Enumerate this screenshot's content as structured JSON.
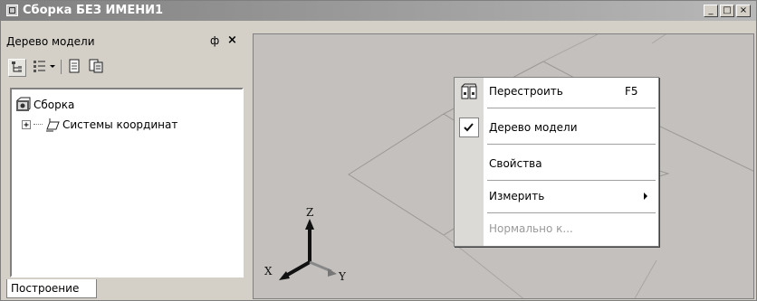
{
  "window": {
    "title": "Сборка БЕЗ ИМЕНИ1",
    "controls": [
      "_",
      "□",
      "×"
    ]
  },
  "panel": {
    "title": "Дерево модели",
    "pin_glyph": "ф",
    "close_glyph": "×",
    "toolbar": [
      {
        "icon": "tree-view-icon"
      },
      {
        "icon": "list-view-icon"
      },
      {
        "icon": "document-icon"
      },
      {
        "icon": "copy-document-icon"
      }
    ],
    "tree": {
      "root": "Сборка",
      "children": [
        "Системы координат"
      ]
    },
    "tab": "Построение"
  },
  "viewport": {
    "axes": {
      "x": "X",
      "y": "Y",
      "z": "Z"
    }
  },
  "context_menu": {
    "items": [
      {
        "label": "Перестроить",
        "shortcut": "F5"
      },
      {
        "label": "Дерево модели",
        "checked": true
      },
      {
        "label": "Свойства"
      },
      {
        "label": "Измерить",
        "submenu": true
      },
      {
        "label": "Нормально к...",
        "disabled": true
      }
    ]
  }
}
